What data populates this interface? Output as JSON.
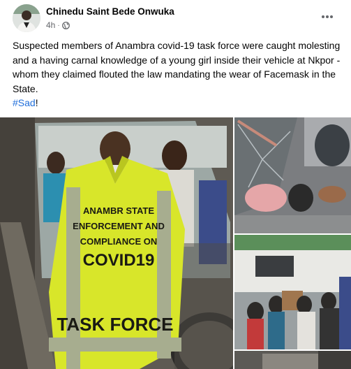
{
  "post": {
    "author": "Chinedu Saint Bede Onwuka",
    "time": "4h",
    "separator": "·",
    "body": "Suspected members of Anambra covid-19 task force were caught molesting and a having carnal knowledge of a young girl inside their vehicle at Nkpor - whom they claimed flouted the law mandating the wear of Facemask in the State.",
    "hashtag": "#Sad",
    "hashtag_suffix": "!"
  },
  "photo_main": {
    "vest_lines": [
      "ANAMBR STATE",
      "ENFORCEMENT AND",
      "COMPLIANCE ON",
      "COVID19"
    ],
    "vest_bottom": "TASK FORCE"
  },
  "icons": {
    "avatar": "profile-photo",
    "privacy": "globe-icon",
    "more": "more-options-icon"
  },
  "colors": {
    "text": "#050505",
    "secondary": "#65676b",
    "hashtag": "#216fdb",
    "vest": "#d8e62a"
  }
}
